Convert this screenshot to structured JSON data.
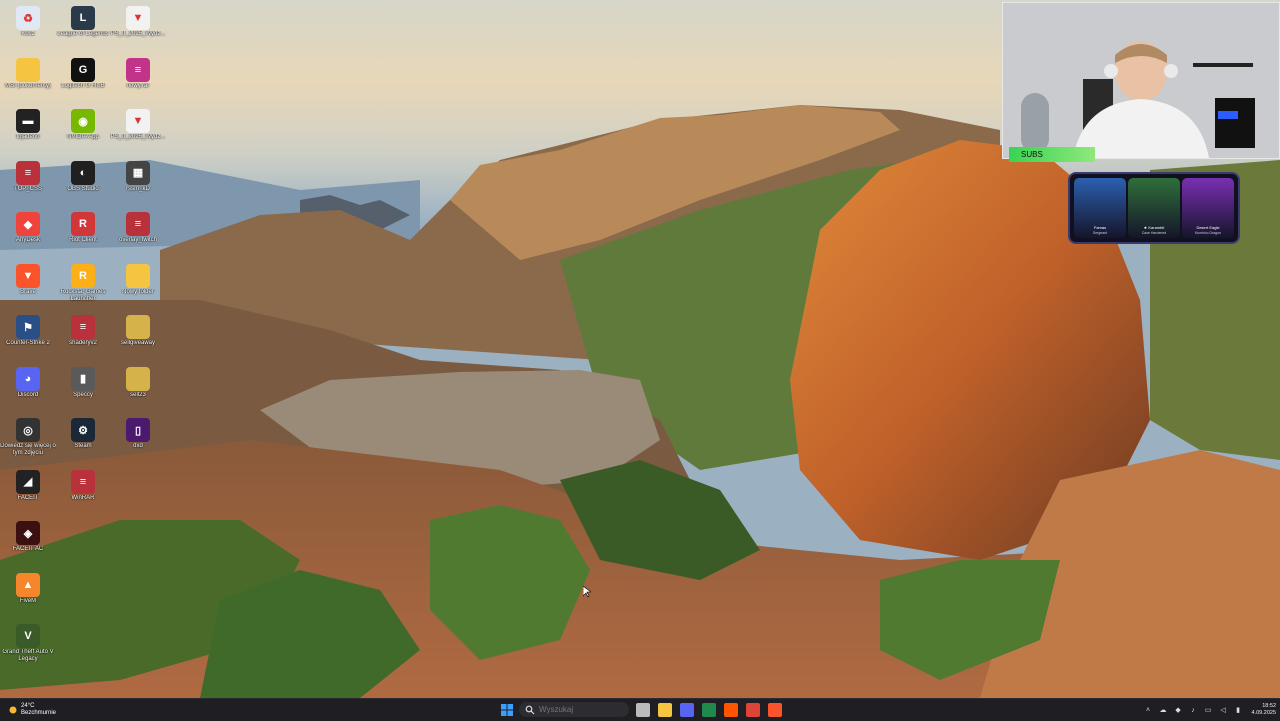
{
  "desktop_icons": [
    {
      "label": "Kosz",
      "icon": "recycle-bin-icon",
      "color": "#dfe9f5",
      "glyph": "♻"
    },
    {
      "label": "League of Legends",
      "icon": "league-of-legends-icon",
      "color": "#2a3a4a",
      "glyph": "L"
    },
    {
      "label": "PS_II_2025_Wydz...",
      "icon": "pdf-file-icon",
      "color": "#f2f2f2",
      "glyph": "▼"
    },
    {
      "label": "MSI (dokumenty)",
      "icon": "folder-icon",
      "color": "#f5c542",
      "glyph": ""
    },
    {
      "label": "Logitech G HUB",
      "icon": "logitech-icon",
      "color": "#111111",
      "glyph": "G"
    },
    {
      "label": "nowy.rar",
      "icon": "rar-archive-icon",
      "color": "#c2338a",
      "glyph": "≡"
    },
    {
      "label": "tojadeno",
      "icon": "shortcut-icon",
      "color": "#222222",
      "glyph": "▬"
    },
    {
      "label": "NVIDIA App",
      "icon": "nvidia-icon",
      "color": "#76b900",
      "glyph": "◉"
    },
    {
      "label": "PS_II_2025_Wydz...",
      "icon": "pdf-file-icon",
      "color": "#f2f2f2",
      "glyph": "▼"
    },
    {
      "label": "TOP_CSS",
      "icon": "rar-archive-icon",
      "color": "#b8313b",
      "glyph": "≡"
    },
    {
      "label": "OBS Studio",
      "icon": "obs-icon",
      "color": "#202020",
      "glyph": "◐"
    },
    {
      "label": "rssm_kD",
      "icon": "video-file-icon",
      "color": "#444444",
      "glyph": "▦"
    },
    {
      "label": "AnyDesk",
      "icon": "anydesk-icon",
      "color": "#ef443b",
      "glyph": "◆"
    },
    {
      "label": "Riot Client",
      "icon": "riot-client-icon",
      "color": "#d13639",
      "glyph": "R"
    },
    {
      "label": "overlay_twitch",
      "icon": "rar-archive-icon",
      "color": "#b8313b",
      "glyph": "≡"
    },
    {
      "label": "Brave",
      "icon": "brave-icon",
      "color": "#fb542b",
      "glyph": "▼"
    },
    {
      "label": "Rockstar Games Launcher",
      "icon": "rockstar-icon",
      "color": "#fcaf17",
      "glyph": "R"
    },
    {
      "label": "Nowy folder",
      "icon": "folder-icon",
      "color": "#f5c542",
      "glyph": ""
    },
    {
      "label": "Counter-Strike 2",
      "icon": "counter-strike-icon",
      "color": "#2a4e86",
      "glyph": "⚑"
    },
    {
      "label": "shaderyv2",
      "icon": "rar-archive-icon",
      "color": "#b8313b",
      "glyph": "≡"
    },
    {
      "label": "sellgiveaway",
      "icon": "folder-icon",
      "color": "#d6b24a",
      "glyph": ""
    },
    {
      "label": "Discord",
      "icon": "discord-icon",
      "color": "#5865f2",
      "glyph": "◕"
    },
    {
      "label": "Speccy",
      "icon": "speccy-icon",
      "color": "#5a5a5a",
      "glyph": "▮"
    },
    {
      "label": "sell23",
      "icon": "folder-icon",
      "color": "#d6b24a",
      "glyph": ""
    },
    {
      "label": "Dowiedz się więcej o tym zdjęciu",
      "icon": "camera-info-icon",
      "color": "#333333",
      "glyph": "◎"
    },
    {
      "label": "Steam",
      "icon": "steam-icon",
      "color": "#1b2838",
      "glyph": "⚙"
    },
    {
      "label": "dxd",
      "icon": "app-icon",
      "color": "#4b1a6e",
      "glyph": "▯"
    },
    {
      "label": "FACEIT",
      "icon": "faceit-icon",
      "color": "#222222",
      "glyph": "◢"
    },
    {
      "label": "WinRAR",
      "icon": "winrar-icon",
      "color": "#b8313b",
      "glyph": "≡"
    },
    {
      "label": "FACEIT AC",
      "icon": "faceit-ac-icon",
      "color": "#3a1010",
      "glyph": "◈"
    },
    {
      "label": "FiveM",
      "icon": "fivem-icon",
      "color": "#f6862c",
      "glyph": "▲"
    },
    {
      "label": "Grand Theft Auto V Legacy",
      "icon": "gta-icon",
      "color": "#3b5a2a",
      "glyph": "V"
    }
  ],
  "overlay": {
    "subs_label": "SUBS",
    "skins": [
      {
        "name": "Famas",
        "sub": "Sergeant",
        "color": "#2c5fb0",
        "icon": "famas-skin-icon"
      },
      {
        "name": "★ Karambit",
        "sub": "Case Hardened",
        "color": "#2f6f3a",
        "icon": "karambit-skin-icon"
      },
      {
        "name": "Desert Eagle",
        "sub": "Kumicho Dragon",
        "color": "#7a2fb3",
        "icon": "deagle-skin-icon"
      }
    ]
  },
  "taskbar": {
    "weather_temp": "24°C",
    "weather_desc": "Bezchmurnie",
    "search_placeholder": "Wyszukaj",
    "time": "18:52",
    "date": "4.09.2025",
    "apps": [
      {
        "name": "taskbar-task-view",
        "color": "#bbbbbb"
      },
      {
        "name": "taskbar-file-explorer",
        "color": "#f5c542"
      },
      {
        "name": "taskbar-discord",
        "color": "#5865f2"
      },
      {
        "name": "taskbar-excel",
        "color": "#1f8a4c"
      },
      {
        "name": "taskbar-faceit",
        "color": "#ff5500"
      },
      {
        "name": "taskbar-chrome",
        "color": "#db4437"
      },
      {
        "name": "taskbar-brave",
        "color": "#fb542b"
      }
    ]
  }
}
